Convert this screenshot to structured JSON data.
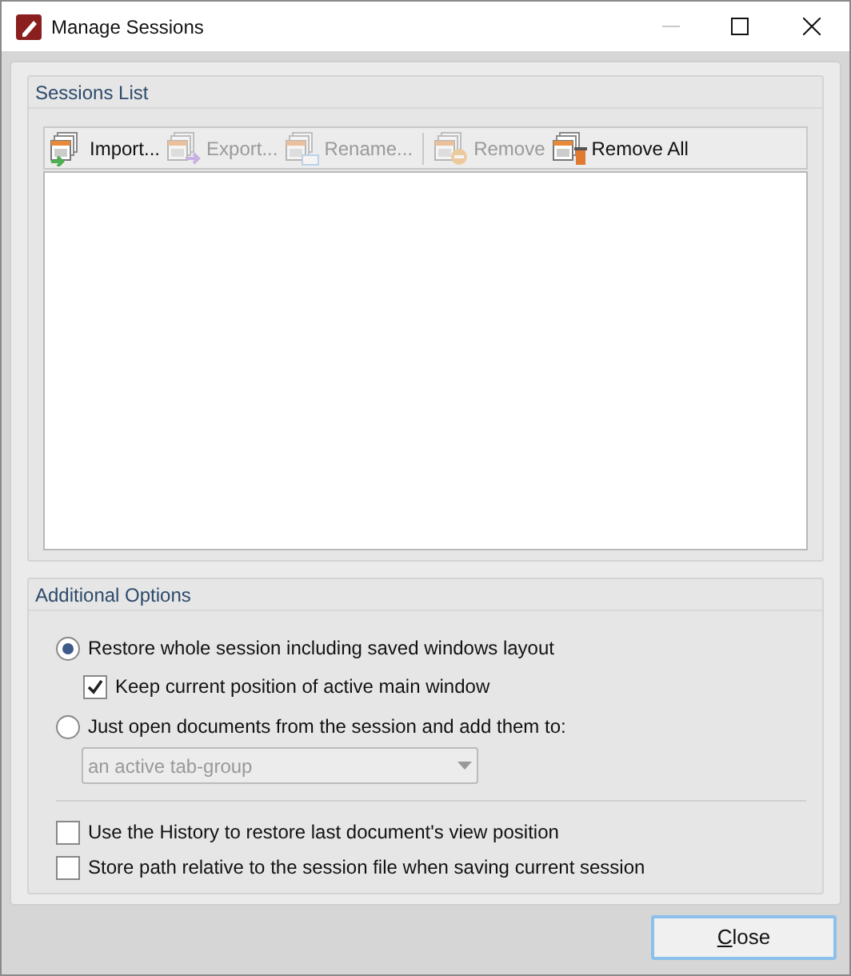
{
  "window": {
    "title": "Manage Sessions"
  },
  "sessions_list": {
    "title": "Sessions List",
    "toolbar": [
      {
        "kind": "import",
        "label": "Import...",
        "disabled": false
      },
      {
        "kind": "export",
        "label": "Export...",
        "disabled": true
      },
      {
        "kind": "rename",
        "label": "Rename...",
        "disabled": true
      },
      {
        "kind": "remove",
        "label": "Remove",
        "disabled": true
      },
      {
        "kind": "remove_all",
        "label": "Remove All",
        "disabled": false
      }
    ]
  },
  "additional_options": {
    "title": "Additional Options",
    "restore_mode": [
      {
        "label": "Restore whole session including saved windows layout",
        "selected": true
      },
      {
        "label": "Just open documents from the session and add them to:",
        "selected": false
      }
    ],
    "keep_position": {
      "label": "Keep current position of active main window",
      "checked": true
    },
    "target": {
      "value": "an active tab-group",
      "disabled": true
    },
    "options": [
      {
        "label": "Use the History to restore last document's view position",
        "checked": false
      },
      {
        "label": "Store path relative to the session file when saving current session",
        "checked": false
      }
    ]
  },
  "close_button": {
    "label": "Close"
  }
}
